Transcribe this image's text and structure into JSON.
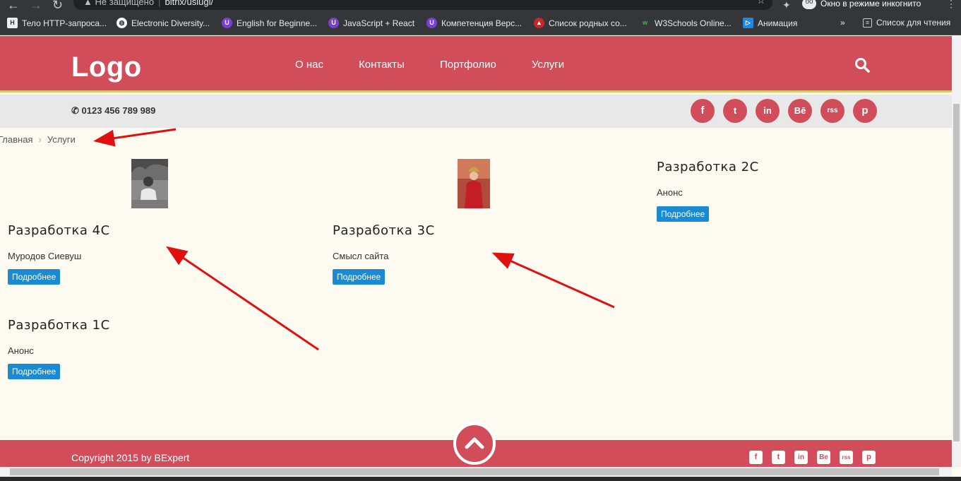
{
  "browser": {
    "security_label": "Не защищено",
    "url": "bitrix/uslugi/",
    "incognito_label": "Окно в режиме инкогнито",
    "bookmarks": [
      {
        "label": "Тело HTTP-запроса...",
        "icon": "file-icon"
      },
      {
        "label": "Electronic Diversity...",
        "icon": "globe-icon"
      },
      {
        "label": "English for Beginne...",
        "icon": "badge-icon"
      },
      {
        "label": "JavaScript + React",
        "icon": "badge-icon"
      },
      {
        "label": "Компетенция Верс...",
        "icon": "badge-icon"
      },
      {
        "label": "Список родных со...",
        "icon": "shield-icon"
      },
      {
        "label": "W3Schools Online...",
        "icon": "w3-icon"
      },
      {
        "label": "Анимация",
        "icon": "code-icon"
      }
    ],
    "more_bookmarks": "»",
    "reading_list": "Список для чтения"
  },
  "header": {
    "logo": "Logo",
    "menu": [
      "О нас",
      "Контакты",
      "Портфолио",
      "Услуги"
    ],
    "phone": "0123 456 789 989",
    "social": [
      "f",
      "t",
      "in",
      "Bē",
      "rss",
      "p"
    ]
  },
  "breadcrumb": {
    "home": "Главная",
    "separator": "›",
    "current": "Услуги"
  },
  "services": [
    {
      "title": "Разработка 4С",
      "anons": "Муродов Сиевуш",
      "button": "Подробнее"
    },
    {
      "title": "Разработка 3С",
      "anons": "Смысл сайта",
      "button": "Подробнее"
    },
    {
      "title": "Разработка 2С",
      "anons": "Анонс",
      "button": "Подробнее"
    },
    {
      "title": "Разработка 1С",
      "anons": "Анонс",
      "button": "Подробнее"
    }
  ],
  "footer": {
    "copyright": "Copyright 2015 by BExpert",
    "social": [
      "f",
      "t",
      "in",
      "Be",
      "rss",
      "p"
    ]
  },
  "colors": {
    "brand": "#d04d59",
    "button": "#1a8ad3",
    "annotation_arrow": "#e01010"
  }
}
